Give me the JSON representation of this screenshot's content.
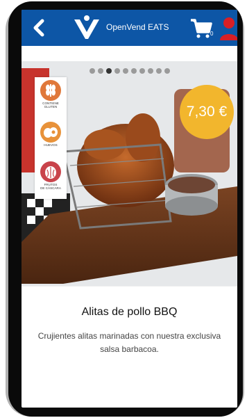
{
  "app": {
    "brand": "OpenVend EATS"
  },
  "header": {
    "cart_count": "0"
  },
  "carousel": {
    "dots": 10,
    "active_index": 2
  },
  "product": {
    "name": "Alitas de pollo BBQ",
    "price": "7,30 €",
    "description_line1": "Crujientes alitas marinadas con nuestra exclusiva",
    "description_line2": "salsa barbacoa."
  },
  "allergens": [
    {
      "label_line1": "CONTIENE",
      "label_line2": "GLUTEN",
      "icon": "wheat-icon",
      "color": "#e0783a"
    },
    {
      "label_line1": "HUEVOS",
      "label_line2": "",
      "icon": "egg-icon",
      "color": "#e8923a"
    },
    {
      "label_line1": "FRUTOS",
      "label_line2": "DE CÁSCARA",
      "icon": "nut-icon",
      "color": "#c9434b"
    }
  ],
  "colors": {
    "topbar": "#0d56a6",
    "price": "#f2b62d",
    "user": "#d81f26"
  }
}
